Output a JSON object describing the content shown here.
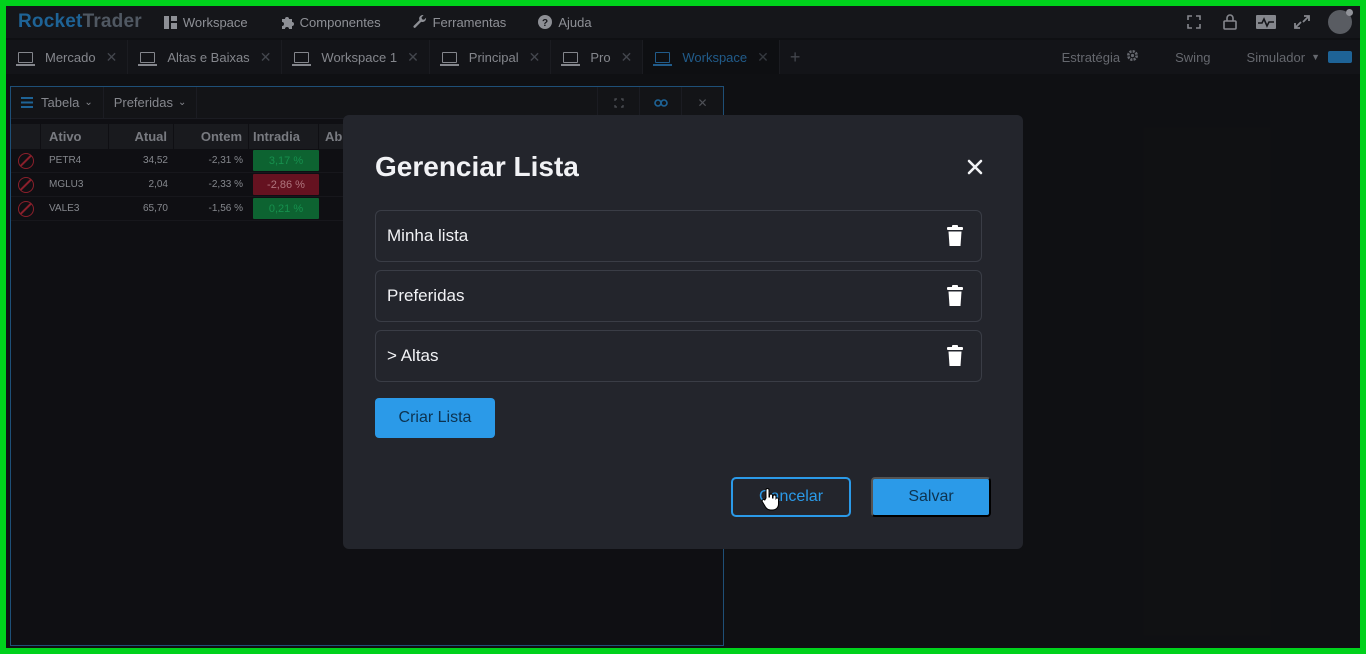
{
  "app": {
    "logo_part1": "Rocket",
    "logo_part2": "Trader"
  },
  "top_menu": [
    {
      "label": "Workspace",
      "icon": "workspace-icon"
    },
    {
      "label": "Componentes",
      "icon": "puzzle-icon"
    },
    {
      "label": "Ferramentas",
      "icon": "wrench-icon"
    },
    {
      "label": "Ajuda",
      "icon": "help-icon"
    }
  ],
  "tabs": [
    {
      "label": "Mercado",
      "active": false
    },
    {
      "label": "Altas e Baixas",
      "active": false
    },
    {
      "label": "Workspace 1",
      "active": false
    },
    {
      "label": "Principal",
      "active": false
    },
    {
      "label": "Pro",
      "active": false
    },
    {
      "label": "Workspace",
      "active": true
    }
  ],
  "tab_right": {
    "strategy": "Estratégia",
    "swing": "Swing",
    "simulator": "Simulador"
  },
  "panel": {
    "view_label": "Tabela",
    "list_label": "Preferidas",
    "columns": [
      "Ativo",
      "Atual",
      "Ontem",
      "Intradia",
      "Ab"
    ],
    "rows": [
      {
        "ativo": "PETR4",
        "atual": "34,52",
        "ontem": "-2,31 %",
        "intradia": "3,17 %",
        "trend": "pos"
      },
      {
        "ativo": "MGLU3",
        "atual": "2,04",
        "ontem": "-2,33 %",
        "intradia": "-2,86 %",
        "trend": "neg"
      },
      {
        "ativo": "VALE3",
        "atual": "65,70",
        "ontem": "-1,56 %",
        "intradia": "0,21 %",
        "trend": "pos"
      }
    ]
  },
  "modal": {
    "title": "Gerenciar Lista",
    "lists": [
      {
        "name": "Minha lista"
      },
      {
        "name": "Preferidas"
      },
      {
        "name": "> Altas"
      }
    ],
    "create_label": "Criar Lista",
    "cancel_label": "Cancelar",
    "save_label": "Salvar"
  },
  "colors": {
    "accent": "#2b9ae8",
    "positive": "#128a45",
    "negative": "#8c1a2d",
    "frame": "#00d21c"
  }
}
